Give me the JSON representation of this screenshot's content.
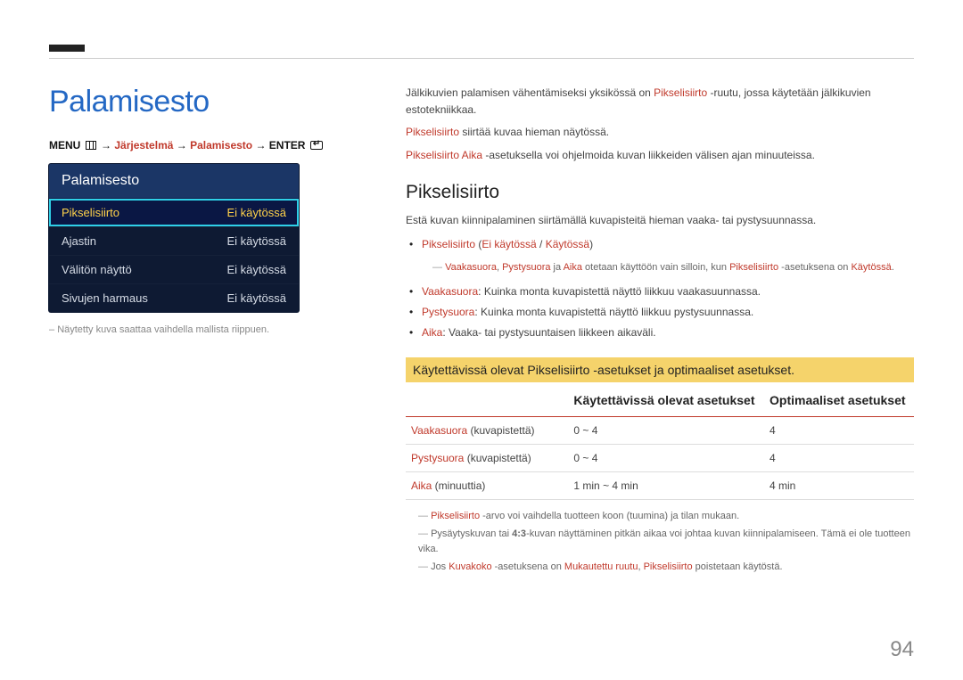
{
  "title": "Palamisesto",
  "breadcrumb": {
    "prefix": "MENU",
    "seg1": "Järjestelmä",
    "seg2": "Palamisesto",
    "suffix": "ENTER"
  },
  "menubox": {
    "header": "Palamisesto",
    "rows": [
      {
        "label": "Pikselisiirto",
        "value": "Ei käytössä",
        "selected": true
      },
      {
        "label": "Ajastin",
        "value": "Ei käytössä",
        "selected": false
      },
      {
        "label": "Välitön näyttö",
        "value": "Ei käytössä",
        "selected": false
      },
      {
        "label": "Sivujen harmaus",
        "value": "Ei käytössä",
        "selected": false
      }
    ]
  },
  "menu_caption": "Näytetty kuva saattaa vaihdella mallista riippuen.",
  "intro": {
    "p1a": "Jälkikuvien palamisen vähentämiseksi yksikössä on ",
    "p1b": "Pikselisiirto",
    "p1c": " -ruutu, jossa käytetään jälkikuvien estotekniikkaa.",
    "p2a": "Pikselisiirto",
    "p2b": " siirtää kuvaa hieman näytössä.",
    "p3a": "Pikselisiirto Aika",
    "p3b": " -asetuksella voi ohjelmoida kuvan liikkeiden välisen ajan minuuteissa."
  },
  "section_heading": "Pikselisiirto",
  "section_intro": "Estä kuvan kiinnipalaminen siirtämällä kuvapisteitä hieman vaaka- tai pystysuunnassa.",
  "bullet1": {
    "a": "Pikselisiirto",
    "b": " (",
    "c": "Ei käytössä",
    "d": " / ",
    "e": "Käytössä",
    "f": ")"
  },
  "subnote1": {
    "a": "Vaakasuora",
    "b": ", ",
    "c": "Pystysuora",
    "d": " ja ",
    "e": "Aika",
    "f": " otetaan käyttöön vain silloin, kun ",
    "g": "Pikselisiirto",
    "h": " -asetuksena on ",
    "i": "Käytössä",
    "j": "."
  },
  "bullet2": {
    "a": "Vaakasuora",
    "b": ": Kuinka monta kuvapistettä näyttö liikkuu vaakasuunnassa."
  },
  "bullet3": {
    "a": "Pystysuora",
    "b": ": Kuinka monta kuvapistettä näyttö liikkuu pystysuunnassa."
  },
  "bullet4": {
    "a": "Aika",
    "b": ": Vaaka- tai pystysuuntaisen liikkeen aikaväli."
  },
  "table_strip": "Käytettävissä olevat Pikselisiirto -asetukset ja optimaaliset asetukset.",
  "table": {
    "col1": "",
    "col2": "Käytettävissä olevat asetukset",
    "col3": "Optimaaliset asetukset",
    "rows": [
      {
        "k1": "Vaakasuora",
        "k2": " (kuvapistettä)",
        "avail": "0 ~ 4",
        "opt": "4"
      },
      {
        "k1": "Pystysuora",
        "k2": " (kuvapistettä)",
        "avail": "0 ~ 4",
        "opt": "4"
      },
      {
        "k1": "Aika",
        "k2": " (minuuttia)",
        "avail": "1 min ~ 4 min",
        "opt": "4 min"
      }
    ]
  },
  "foot1": {
    "a": "Pikselisiirto",
    "b": " -arvo voi vaihdella tuotteen koon (tuumina) ja tilan mukaan."
  },
  "foot2": {
    "a": "Pysäytyskuvan tai ",
    "b": "4:3",
    "c": "-kuvan näyttäminen pitkän aikaa voi johtaa kuvan kiinnipalamiseen. Tämä ei ole tuotteen vika."
  },
  "foot3": {
    "a": "Jos ",
    "b": "Kuvakoko",
    "c": " -asetuksena on ",
    "d": "Mukautettu ruutu",
    "e": ", ",
    "f": "Pikselisiirto",
    "g": " poistetaan käytöstä."
  },
  "page_number": "94"
}
